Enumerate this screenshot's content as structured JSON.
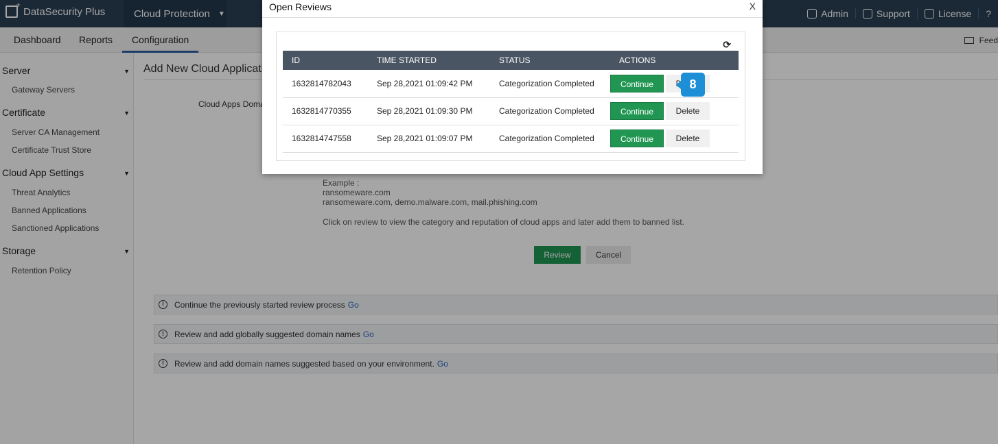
{
  "header": {
    "app_name": "DataSecurity Plus",
    "product": "Cloud Protection",
    "admin": "Admin",
    "support": "Support",
    "license": "License",
    "help": "?"
  },
  "nav": {
    "tabs": [
      "Dashboard",
      "Reports",
      "Configuration"
    ],
    "active": "Configuration",
    "feedback": "Feed"
  },
  "sidebar": {
    "groups": [
      {
        "label": "Server",
        "items": [
          "Gateway Servers"
        ]
      },
      {
        "label": "Certificate",
        "items": [
          "Server CA Management",
          "Certificate Trust Store"
        ]
      },
      {
        "label": "Cloud App Settings",
        "items": [
          "Threat Analytics",
          "Banned Applications",
          "Sanctioned Applications"
        ]
      },
      {
        "label": "Storage",
        "items": [
          "Retention Policy"
        ]
      }
    ]
  },
  "main": {
    "title": "Add New Cloud Applicati",
    "field_label": "Cloud Apps Doma",
    "example_label": "Example :",
    "example_1": "ransomeware.com",
    "example_2": "ransomeware.com, demo.malware.com, mail.phishing.com",
    "help_text": "Click on review to view the category and reputation of cloud apps and later add them to banned list.",
    "review_button": "Review",
    "cancel_button": "Cancel",
    "info_bars": [
      {
        "text": "Continue the previously started review process",
        "link": "Go"
      },
      {
        "text": "Review and add globally suggested domain names",
        "link": "Go"
      },
      {
        "text": "Review and add domain names suggested based on your environment.",
        "link": "Go"
      }
    ]
  },
  "modal": {
    "title": "Open Reviews",
    "close": "X",
    "columns": [
      "ID",
      "TIME STARTED",
      "STATUS",
      "ACTIONS"
    ],
    "rows": [
      {
        "id": "1632814782043",
        "time": "Sep 28,2021 01:09:42 PM",
        "status": "Categorization Completed",
        "continue": "Continue",
        "delete": "Delete"
      },
      {
        "id": "1632814770355",
        "time": "Sep 28,2021 01:09:30 PM",
        "status": "Categorization Completed",
        "continue": "Continue",
        "delete": "Delete"
      },
      {
        "id": "1632814747558",
        "time": "Sep 28,2021 01:09:07 PM",
        "status": "Categorization Completed",
        "continue": "Continue",
        "delete": "Delete"
      }
    ]
  },
  "step_badge": "8",
  "colors": {
    "accent_green": "#219653",
    "header_bg": "#2a3f54",
    "table_header": "#4a5563",
    "badge": "#1d8fd6"
  }
}
